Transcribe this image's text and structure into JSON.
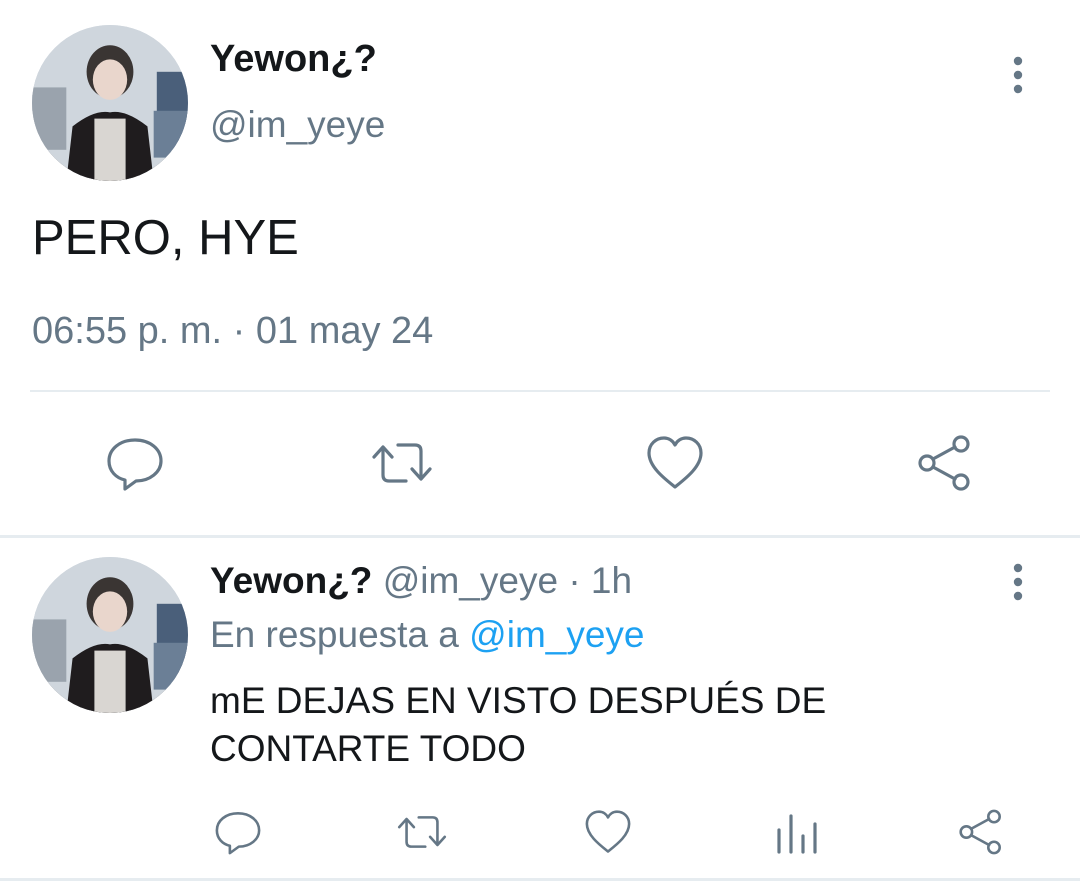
{
  "main_tweet": {
    "display_name": "Yewon¿?",
    "handle": "@im_yeye",
    "text": "PERO, HYE",
    "timestamp": "06:55 p. m. · 01 may 24",
    "icons": [
      "reply-icon",
      "retweet-icon",
      "like-icon",
      "share-icon",
      "more-options-icon"
    ]
  },
  "reply_tweet": {
    "display_name": "Yewon¿?",
    "handle": "@im_yeye",
    "age": "· 1h",
    "reply_to_label": "En respuesta a",
    "reply_to_handle": "@im_yeye",
    "text": "mE DEJAS EN VISTO DESPUÉS DE CONTARTE TODO",
    "icons": [
      "reply-icon",
      "retweet-icon",
      "like-icon",
      "stats-icon",
      "share-icon",
      "more-options-icon"
    ]
  },
  "colors": {
    "text_primary": "#14171a",
    "text_secondary": "#657786",
    "link": "#1da1f2",
    "divider": "#e6ecf0"
  }
}
